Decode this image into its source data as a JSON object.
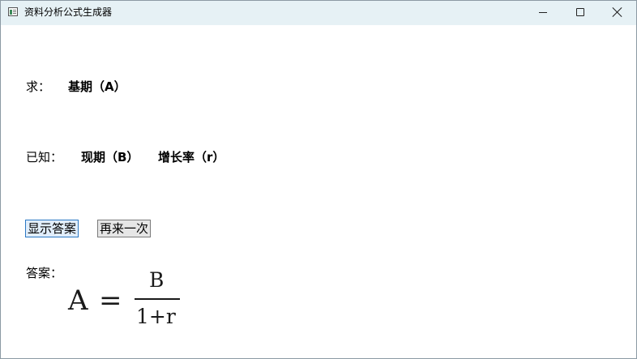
{
  "window": {
    "title": "资料分析公式生成器",
    "controls": [
      "minimize-icon",
      "maximize-icon",
      "close-icon"
    ]
  },
  "question": {
    "find_label": "求：",
    "find_target": "基期（A）",
    "known_label": "已知：",
    "known_items": [
      "现期（B）",
      "增长率（r）"
    ]
  },
  "buttons": {
    "show_answer": "显示答案",
    "try_again": "再来一次"
  },
  "answer": {
    "label": "答案：",
    "formula": {
      "lhs": "A",
      "equals": "=",
      "numerator": "B",
      "denominator": "1+r"
    }
  },
  "colors": {
    "titlebar": "#e6f1f5",
    "primary_button_border": "#2b78c4",
    "primary_button_fill": "#e1eefb",
    "button_border": "#7a7a7a",
    "button_fill": "#e6e6e6"
  }
}
